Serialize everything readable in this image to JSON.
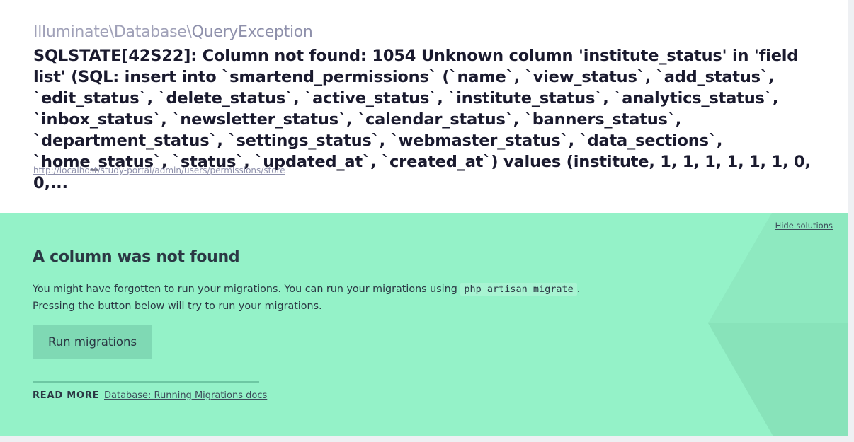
{
  "error": {
    "exception_class_parts": [
      "Illuminate",
      "Database",
      "QueryException"
    ],
    "message": "SQLSTATE[42S22]: Column not found: 1054 Unknown column 'institute_status' in 'field list' (SQL: insert into `smartend_permissions` (`name`, `view_status`, `add_status`, `edit_status`, `delete_status`, `active_status`, `institute_status`, `analytics_status`, `inbox_status`, `newsletter_status`, `calendar_status`, `banners_status`, `department_status`, `settings_status`, `webmaster_status`, `data_sections`, `home_status`, `status`, `updated_at`, `created_at`) values (institute, 1, 1, 1, 1, 1, 1, 0, 0,...",
    "url": "http://localhost/study-portal/admin/users/permissions/store"
  },
  "solution": {
    "hide_label": "Hide solutions",
    "title": "A column was not found",
    "desc_before_code": "You might have forgotten to run your migrations. You can run your migrations using ",
    "code": "php artisan migrate",
    "desc_after_code": ".",
    "desc_line2": "Pressing the button below will try to run your migrations.",
    "button_label": "Run migrations",
    "read_more_label": "READ MORE",
    "doc_link_label": "Database: Running Migrations docs"
  },
  "colors": {
    "panel_bg": "#94f2c8",
    "button_bg": "#7fd9b4",
    "text_dark": "#2b3844",
    "muted_class": "#a0a1b8"
  }
}
